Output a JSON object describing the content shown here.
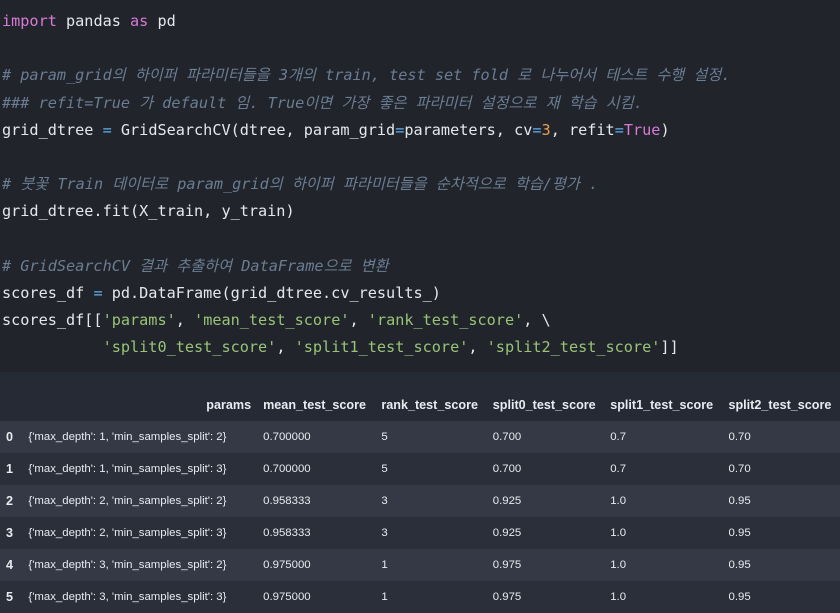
{
  "code_lines": [
    [
      {
        "t": "import",
        "c": "kw"
      },
      {
        "t": " pandas "
      },
      {
        "t": "as",
        "c": "kw"
      },
      {
        "t": " pd"
      }
    ],
    [],
    [
      {
        "t": "# param_grid의 하이퍼 파라미터들을 3개의 train, test set fold 로 나누어서 테스트 수행 설정.",
        "c": "com"
      }
    ],
    [
      {
        "t": "### refit=True 가 default 임. True이면 가장 좋은 파라미터 설정으로 재 학습 시킴.",
        "c": "com"
      }
    ],
    [
      {
        "t": "grid_dtree "
      },
      {
        "t": "=",
        "c": "op"
      },
      {
        "t": " GridSearchCV(dtree, param_grid"
      },
      {
        "t": "=",
        "c": "op"
      },
      {
        "t": "parameters, cv"
      },
      {
        "t": "=",
        "c": "op"
      },
      {
        "t": "3",
        "c": "num"
      },
      {
        "t": ", refit"
      },
      {
        "t": "=",
        "c": "op"
      },
      {
        "t": "True",
        "c": "bool"
      },
      {
        "t": ")"
      }
    ],
    [],
    [
      {
        "t": "# 붓꽃 Train 데이터로 param_grid의 하이퍼 파라미터들을 순차적으로 학습/평가 .",
        "c": "com"
      }
    ],
    [
      {
        "t": "grid_dtree.fit(X_train, y_train)"
      }
    ],
    [],
    [
      {
        "t": "# GridSearchCV 결과 추출하여 DataFrame으로 변환",
        "c": "com"
      }
    ],
    [
      {
        "t": "scores_df "
      },
      {
        "t": "=",
        "c": "op"
      },
      {
        "t": " pd.DataFrame(grid_dtree.cv_results_)"
      }
    ],
    [
      {
        "t": "scores_df[["
      },
      {
        "t": "'params'",
        "c": "str"
      },
      {
        "t": ", "
      },
      {
        "t": "'mean_test_score'",
        "c": "str"
      },
      {
        "t": ", "
      },
      {
        "t": "'rank_test_score'",
        "c": "str"
      },
      {
        "t": ", \\"
      }
    ],
    [
      {
        "t": "           "
      },
      {
        "t": "'split0_test_score'",
        "c": "str"
      },
      {
        "t": ", "
      },
      {
        "t": "'split1_test_score'",
        "c": "str"
      },
      {
        "t": ", "
      },
      {
        "t": "'split2_test_score'",
        "c": "str"
      },
      {
        "t": "]]"
      }
    ]
  ],
  "table": {
    "columns": [
      "params",
      "mean_test_score",
      "rank_test_score",
      "split0_test_score",
      "split1_test_score",
      "split2_test_score"
    ],
    "rows": [
      {
        "index": "0",
        "cells": [
          "{'max_depth': 1, 'min_samples_split': 2}",
          "0.700000",
          "5",
          "0.700",
          "0.7",
          "0.70"
        ]
      },
      {
        "index": "1",
        "cells": [
          "{'max_depth': 1, 'min_samples_split': 3}",
          "0.700000",
          "5",
          "0.700",
          "0.7",
          "0.70"
        ]
      },
      {
        "index": "2",
        "cells": [
          "{'max_depth': 2, 'min_samples_split': 2}",
          "0.958333",
          "3",
          "0.925",
          "1.0",
          "0.95"
        ]
      },
      {
        "index": "3",
        "cells": [
          "{'max_depth': 2, 'min_samples_split': 3}",
          "0.958333",
          "3",
          "0.925",
          "1.0",
          "0.95"
        ]
      },
      {
        "index": "4",
        "cells": [
          "{'max_depth': 3, 'min_samples_split': 2}",
          "0.975000",
          "1",
          "0.975",
          "1.0",
          "0.95"
        ]
      },
      {
        "index": "5",
        "cells": [
          "{'max_depth': 3, 'min_samples_split': 3}",
          "0.975000",
          "1",
          "0.975",
          "1.0",
          "0.95"
        ]
      }
    ]
  }
}
